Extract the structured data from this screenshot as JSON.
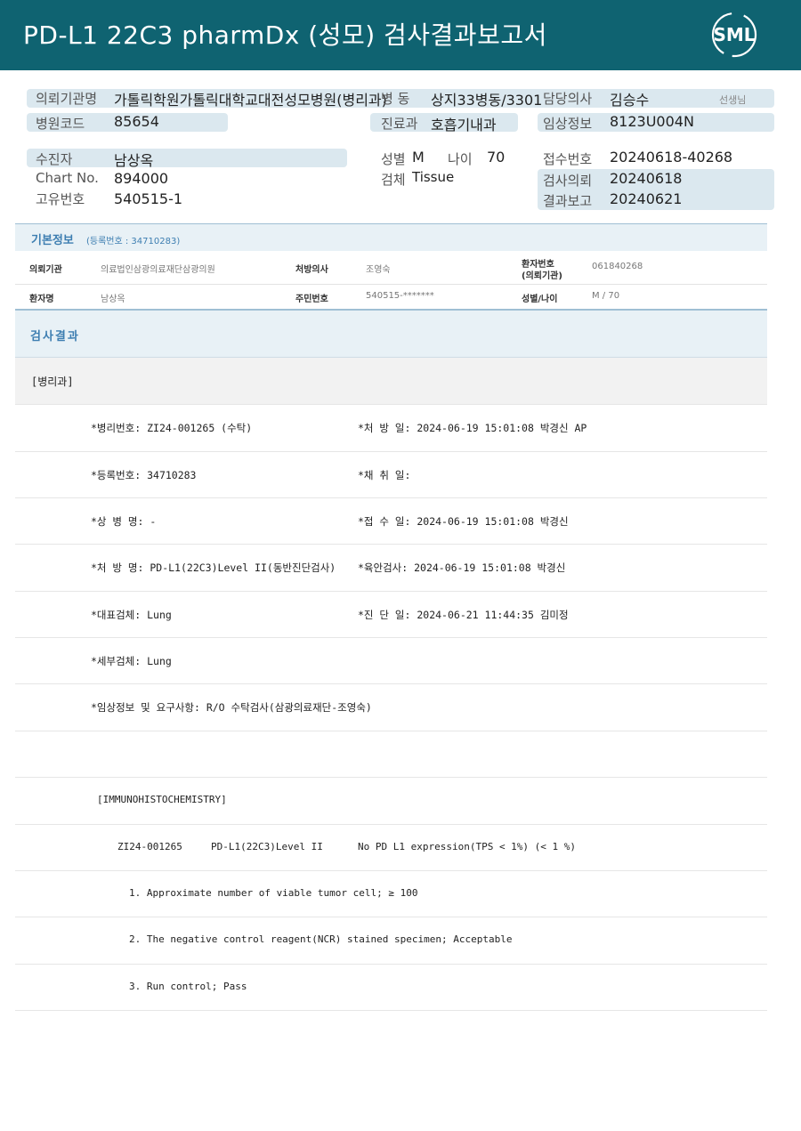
{
  "header": {
    "title": "PD-L1  22C3  pharmDx  (성모)  검사결과보고서",
    "logo_text": "SML"
  },
  "info": {
    "institution_label": "의뢰기관명",
    "institution_value": "가톨릭학원가톨릭대학교대전성모병원(병리과)",
    "ward_label": "병  동",
    "ward_value": "상지33병동/3301",
    "doctor_label": "담당의사",
    "doctor_value": "김승수",
    "doctor_suffix": "선생님",
    "hospital_code_label": "병원코드",
    "hospital_code_value": "85654",
    "dept_label": "진료과",
    "dept_value": "호흡기내과",
    "clinical_label": "임상정보",
    "clinical_value": "8123U004N",
    "patient_label": "수진자",
    "patient_value": "남상옥",
    "sex_label": "성별",
    "sex_value": "M",
    "age_label": "나이",
    "age_value": "70",
    "receipt_label": "접수번호",
    "receipt_value": "20240618-40268",
    "chart_label": "Chart No.",
    "chart_value": "894000",
    "specimen_label": "검체",
    "specimen_value": "Tissue",
    "request_label": "검사의뢰",
    "request_value": "20240618",
    "uid_label": "고유번호",
    "uid_value": "540515-1",
    "report_label": "결과보고",
    "report_value": "20240621"
  },
  "basic": {
    "title": "기본정보",
    "reg": "(등록번호 : 34710283)",
    "r1": [
      {
        "label": "의뢰기관",
        "value": "의료법인삼광의료재단삼광의원"
      },
      {
        "label": "처방의사",
        "value": "조영숙"
      },
      {
        "label": "환자번호",
        "label2": "(의뢰기관)",
        "value": "061840268"
      }
    ],
    "r2": [
      {
        "label": "환자명",
        "value": "남상옥"
      },
      {
        "label": "주민번호",
        "value": "540515-*******"
      },
      {
        "label": "성별/나이",
        "value": "M / 70"
      }
    ]
  },
  "results": {
    "title": "검사결과",
    "dept": "[병리과]",
    "rows": [
      {
        "left": "*병리번호: ZI24-001265 (수탁)",
        "right": "*처 방 일: 2024-06-19 15:01:08  박경신 AP"
      },
      {
        "left": "*등록번호: 34710283",
        "right": "*채 취 일:"
      },
      {
        "left": "*상 병 명: -",
        "right": "*접 수 일: 2024-06-19 15:01:08  박경신"
      },
      {
        "left": "*처 방 명: PD-L1(22C3)Level II(동반진단검사)",
        "right": "*육안검사: 2024-06-19 15:01:08  박경신"
      },
      {
        "left": "*대표검체: Lung",
        "right": "*진 단 일: 2024-06-21 11:44:35  김미정"
      },
      {
        "left": "*세부검체: Lung",
        "right": ""
      },
      {
        "left": "*임상정보 및 요구사항: R/O 수탁검사(삼광의료재단-조영숙)",
        "right": ""
      }
    ],
    "ihc_title": "[IMMUNOHISTOCHEMISTRY]",
    "ihc_line": {
      "id": "ZI24-001265",
      "test": "PD-L1(22C3)Level II",
      "result": "No PD L1 expression(TPS < 1%) (< 1 %)"
    },
    "items": [
      "1. Approximate number of viable tumor cell; ≥ 100",
      "2. The negative control reagent(NCR) stained specimen; Acceptable",
      "3. Run control; Pass"
    ]
  },
  "colors": {
    "header_bg": "#0f6371",
    "band": "#dbe8ef",
    "accent": "#3d7eb1"
  }
}
